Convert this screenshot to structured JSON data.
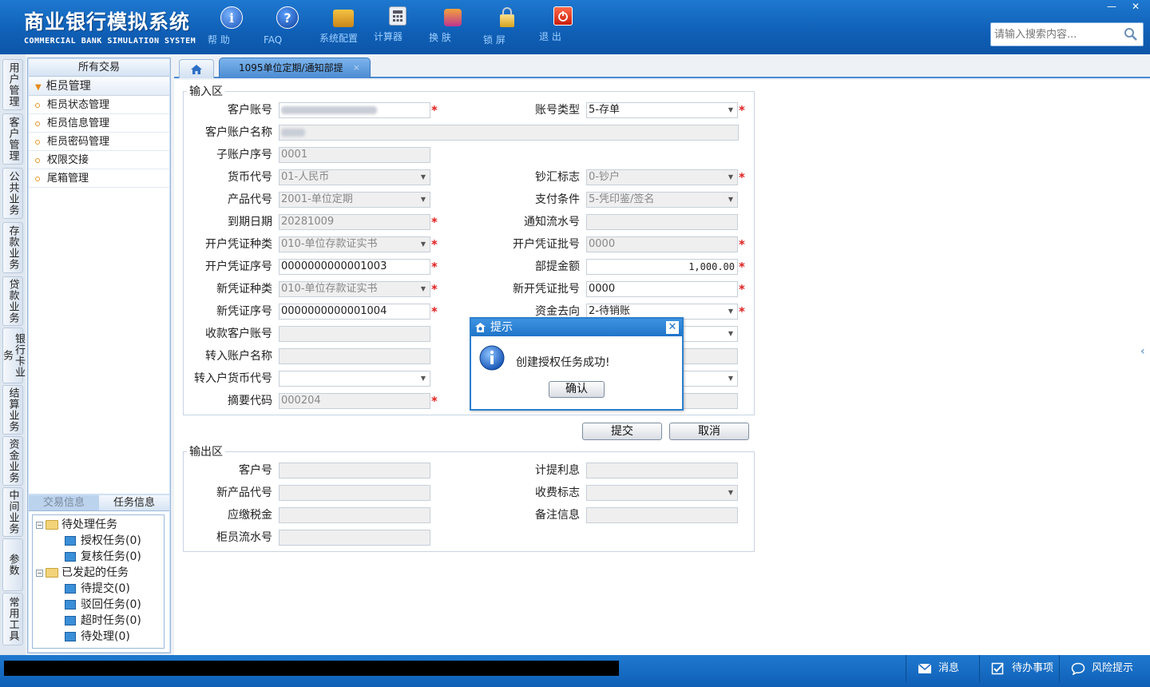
{
  "brand": {
    "title_cn": "商业银行模拟系统",
    "title_en": "COMMERCIAL BANK SIMULATION SYSTEM"
  },
  "toolbar": [
    {
      "id": "help",
      "label": "帮 助",
      "icon": "info-icon"
    },
    {
      "id": "faq",
      "label": "FAQ",
      "icon": "question-icon"
    },
    {
      "id": "config",
      "label": "系统配置",
      "icon": "toolbox-icon"
    },
    {
      "id": "calc",
      "label": "计算器",
      "icon": "calculator-icon"
    },
    {
      "id": "skin",
      "label": "换 肤",
      "icon": "shirt-icon"
    },
    {
      "id": "lock",
      "label": "锁 屏",
      "icon": "lock-icon"
    },
    {
      "id": "exit",
      "label": "退 出",
      "icon": "power-icon"
    }
  ],
  "window": {
    "minimize": "—",
    "close": "✕"
  },
  "search": {
    "placeholder": "请输入搜索内容..."
  },
  "vtabs": [
    "用户管理",
    "客户管理",
    "公共业务",
    "存款业务",
    "贷款业务",
    "银行卡业务",
    "结算业务",
    "资金业务",
    "中间业务",
    "参数",
    "常用工具"
  ],
  "menu": {
    "header": "所有交易",
    "group": "柜员管理",
    "items": [
      "柜员状态管理",
      "柜员信息管理",
      "柜员密码管理",
      "权限交接",
      "尾箱管理"
    ]
  },
  "tasks": {
    "tab_trade": "交易信息",
    "tab_task": "任务信息",
    "pending": "待处理任务",
    "auth": "授权任务(0)",
    "review": "复核任务(0)",
    "started": "已发起的任务",
    "to_submit": "待提交(0)",
    "rejected": "驳回任务(0)",
    "timeout": "超时任务(0)",
    "processing": "待处理(0)"
  },
  "tab": {
    "title": "1095单位定期/通知部提",
    "close": "×"
  },
  "input": {
    "legend": "输入区",
    "cust_acct_label": "客户账号",
    "acct_type_label": "账号类型",
    "acct_type_value": "5-存单",
    "cust_name_label": "客户账户名称",
    "sub_seq_label": "子账户序号",
    "sub_seq_value": "0001",
    "currency_label": "货币代号",
    "currency_value": "01-人民币",
    "cash_flag_label": "钞汇标志",
    "cash_flag_value": "0-钞户",
    "product_label": "产品代号",
    "product_value": "2001-单位定期",
    "pay_cond_label": "支付条件",
    "pay_cond_value": "5-凭印鉴/签名",
    "due_date_label": "到期日期",
    "due_date_value": "20281009",
    "notice_no_label": "通知流水号",
    "notice_no_value": "",
    "open_vtype_label": "开户凭证种类",
    "open_vtype_value": "010-单位存款证实书",
    "open_vbatch_label": "开户凭证批号",
    "open_vbatch_value": "0000",
    "open_vseq_label": "开户凭证序号",
    "open_vseq_value": "0000000000001003",
    "partial_amt_label": "部提金额",
    "partial_amt_value": "1,000.00",
    "new_vtype_label": "新凭证种类",
    "new_vtype_value": "010-单位存款证实书",
    "new_vbatch_label": "新开凭证批号",
    "new_vbatch_value": "0000",
    "new_vseq_label": "新凭证序号",
    "new_vseq_value": "0000000000001004",
    "fund_dir_label": "资金去向",
    "fund_dir_value": "2-待销账",
    "recv_acct_label": "收款客户账号",
    "in_name_label": "转入账户名称",
    "in_currency_label": "转入户货币代号",
    "summary_label": "摘要代码",
    "summary_value": "000204"
  },
  "buttons": {
    "submit": "提交",
    "cancel": "取消"
  },
  "output": {
    "legend": "输出区",
    "cust_no_label": "客户号",
    "accrued_label": "计提利息",
    "new_prod_label": "新产品代号",
    "fee_flag_label": "收费标志",
    "tax_label": "应缴税金",
    "remark_label": "备注信息",
    "teller_seq_label": "柜员流水号"
  },
  "dialog": {
    "title": "提示",
    "message": "创建授权任务成功!",
    "ok": "确认",
    "close": "✕"
  },
  "statusbar": {
    "msg": "消息",
    "todo": "待办事项",
    "risk": "风险提示"
  },
  "colors": {
    "header_blue": "#0f5fb6",
    "required_red": "#e02020",
    "dialog_border": "#2b7fd0"
  }
}
